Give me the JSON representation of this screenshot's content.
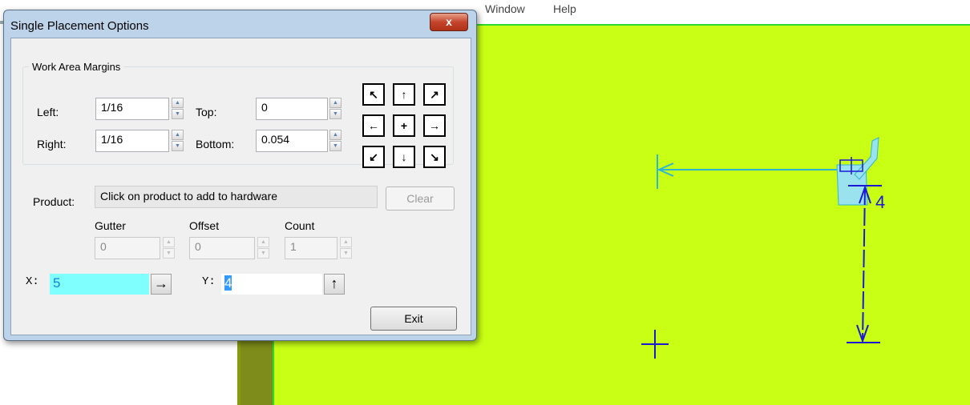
{
  "menubar": {
    "items": [
      "Window",
      "Help"
    ]
  },
  "dialog": {
    "title": "Single Placement Options",
    "close_label": "x",
    "margins": {
      "legend": "Work Area Margins",
      "left_label": "Left:",
      "left_value": "1/16",
      "right_label": "Right:",
      "right_value": "1/16",
      "top_label": "Top:",
      "top_value": "0",
      "bottom_label": "Bottom:",
      "bottom_value": "0.054"
    },
    "nav_arrows": [
      "↖",
      "↑",
      "↗",
      "←",
      "+",
      "→",
      "↙",
      "↓",
      "↘"
    ],
    "product": {
      "label": "Product:",
      "value": "Click on product to add to hardware",
      "clear_label": "Clear"
    },
    "layout": {
      "gutter_label": "Gutter",
      "gutter_value": "0",
      "offset_label": "Offset",
      "offset_value": "0",
      "count_label": "Count",
      "count_value": "1"
    },
    "coords": {
      "x_label": "X:",
      "x_value": "5",
      "x_arrow": "→",
      "y_label": "Y:",
      "y_value": "4",
      "y_arrow": "↑"
    },
    "exit_label": "Exit"
  },
  "canvas": {
    "dimension_label": "4",
    "background_color": "#c9ff15",
    "drawing_color": "#1a1ad4",
    "accent_color": "#2fb5d0"
  }
}
